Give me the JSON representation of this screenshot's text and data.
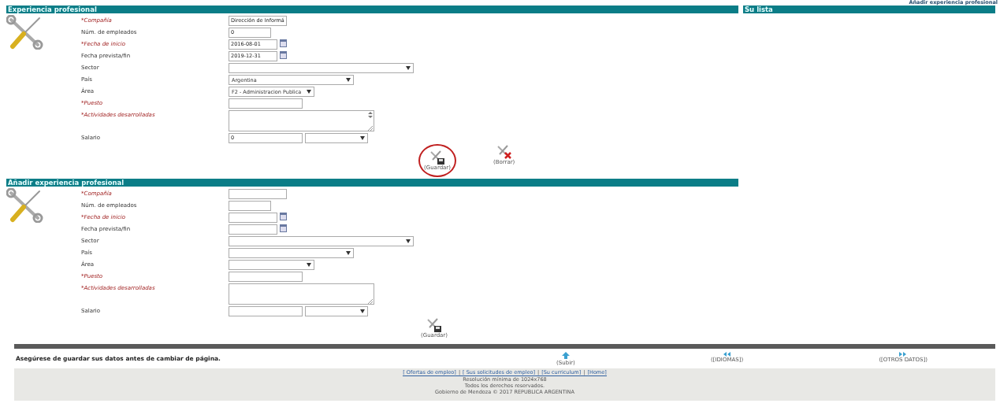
{
  "top_link": "Añadir experiencia profesional",
  "sections": [
    {
      "title": "Experiencia profesional",
      "fields": [
        {
          "label": "*Compañía",
          "required": true,
          "kind": "text",
          "value": "Dirección de Informá"
        },
        {
          "label": "Núm. de empleados",
          "required": false,
          "kind": "text",
          "value": "0"
        },
        {
          "label": "*Fecha de inicio",
          "required": true,
          "kind": "date",
          "value": "2016-08-01"
        },
        {
          "label": "Fecha prevista/fin",
          "required": false,
          "kind": "date",
          "value": "2019-12-31"
        },
        {
          "label": "Sector",
          "required": false,
          "kind": "select"
        },
        {
          "label": "País",
          "required": false,
          "kind": "select",
          "value": "Argentina"
        },
        {
          "label": "Área",
          "required": false,
          "kind": "select",
          "value": "F2 - Administracion Publica"
        },
        {
          "label": "*Puesto",
          "required": true,
          "kind": "text"
        },
        {
          "label": "*Actividades desarrolladas",
          "required": true,
          "kind": "textarea",
          "scrollbar": true
        },
        {
          "label": "Salario",
          "required": false,
          "kind": "salary",
          "value": "0"
        }
      ],
      "buttons": [
        {
          "label": "(Guardar)",
          "kind": "save",
          "highlighted": true
        },
        {
          "label": "(Borrar)",
          "kind": "delete",
          "highlighted": false
        }
      ]
    },
    {
      "title": "Añadir experiencia profesional",
      "fields": [
        {
          "label": "*Compañía",
          "required": true,
          "kind": "text"
        },
        {
          "label": "Núm. de empleados",
          "required": false,
          "kind": "text"
        },
        {
          "label": "*Fecha de inicio",
          "required": true,
          "kind": "date"
        },
        {
          "label": "Fecha prevista/fin",
          "required": false,
          "kind": "date"
        },
        {
          "label": "Sector",
          "required": false,
          "kind": "select"
        },
        {
          "label": "País",
          "required": false,
          "kind": "select"
        },
        {
          "label": "Área",
          "required": false,
          "kind": "select"
        },
        {
          "label": "*Puesto",
          "required": true,
          "kind": "text"
        },
        {
          "label": "*Actividades desarrolladas",
          "required": true,
          "kind": "textarea",
          "scrollbar": false
        },
        {
          "label": "Salario",
          "required": false,
          "kind": "salary"
        }
      ],
      "buttons": [
        {
          "label": "(Guardar)",
          "kind": "save",
          "highlighted": false
        }
      ]
    }
  ],
  "side_panel": {
    "title": "Su lista"
  },
  "notice": "Asegúrese de guardar sus datos antes de cambiar de página.",
  "nav": [
    {
      "label": "(Subir)",
      "kind": "up"
    },
    {
      "label": "([IDIOMAS])",
      "kind": "prev"
    },
    {
      "label": "([OTROS DATOS])",
      "kind": "next"
    }
  ],
  "footer_links": [
    "[ Ofertas de empleo]",
    "[ Sus solicitudes de empleo]",
    "[Su curriculum]",
    "[Home]"
  ],
  "footer_separator": "|",
  "footer_lines": [
    "Resolución mínima de 1024x768",
    "Todos los derechos reservados.",
    "Gobierno de Mendoza © 2017 REPUBLICA ARGENTINA"
  ]
}
